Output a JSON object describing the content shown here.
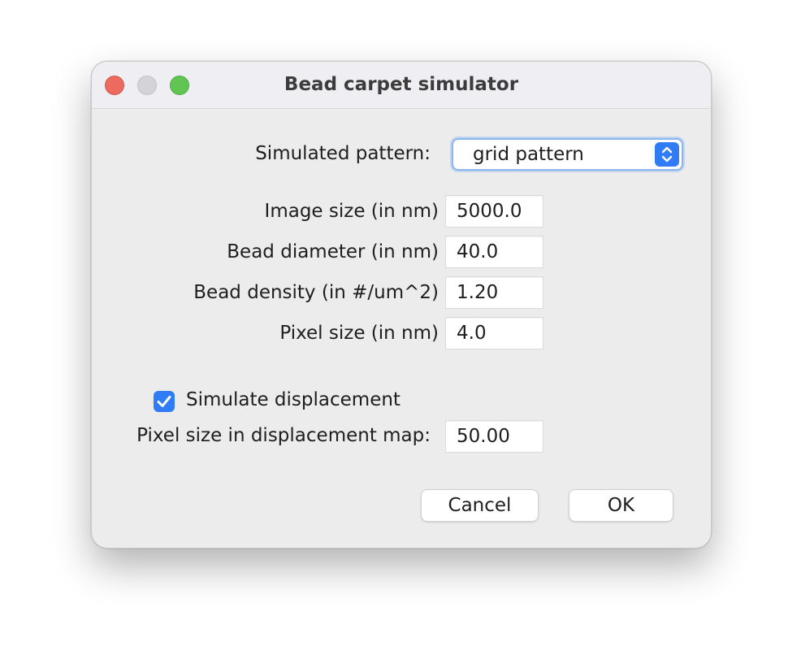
{
  "window": {
    "title": "Bead carpet simulator"
  },
  "pattern": {
    "label": "Simulated pattern:",
    "selected": "grid pattern"
  },
  "fields": [
    {
      "label": "Image size (in nm)",
      "value": "5000.0"
    },
    {
      "label": "Bead diameter (in nm)",
      "value": "40.0"
    },
    {
      "label": "Bead density (in #/um^2)",
      "value": "1.20"
    },
    {
      "label": "Pixel size (in nm)",
      "value": "4.0"
    }
  ],
  "displacement": {
    "checkbox_label": "Simulate displacement",
    "checked": true,
    "map_label": "Pixel size in displacement map:",
    "map_value": "50.00"
  },
  "buttons": {
    "cancel": "Cancel",
    "ok": "OK"
  },
  "colors": {
    "accent": "#2f7cf6",
    "close": "#ec6a5e",
    "minimize": "#d4d3d7",
    "maximize": "#61c554"
  },
  "icons": {
    "stepper": "up-down-chevron-icon",
    "check": "checkmark-icon"
  }
}
